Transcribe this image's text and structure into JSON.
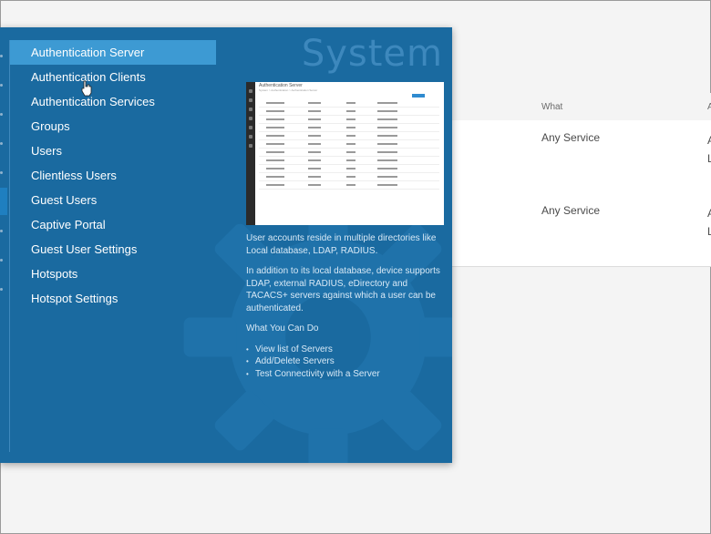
{
  "background": {
    "columns": {
      "what": "What",
      "second": "A"
    },
    "rows": [
      {
        "what": "Any Service",
        "second": [
          "A",
          "L"
        ]
      },
      {
        "what": "Any Service",
        "second": [
          "A",
          "L"
        ]
      }
    ]
  },
  "panel": {
    "title": "System",
    "nav": {
      "items": [
        {
          "label": "Authentication Server",
          "active": true
        },
        {
          "label": "Authentication Clients"
        },
        {
          "label": "Authentication Services"
        },
        {
          "label": "Groups"
        },
        {
          "label": "Users"
        },
        {
          "label": "Clientless Users"
        },
        {
          "label": "Guest Users"
        },
        {
          "label": "Captive Portal"
        },
        {
          "label": "Guest User Settings"
        },
        {
          "label": "Hotspots"
        },
        {
          "label": "Hotspot Settings"
        }
      ]
    },
    "preview": {
      "title": "Authentication Server",
      "breadcrumb": "System > Authentication > Authentication Server"
    },
    "description": {
      "para1": "User accounts reside in multiple directories like Local database, LDAP, RADIUS.",
      "para2": "In addition to its local database, device supports LDAP, external RADIUS, eDirectory and TACACS+ servers against which a user can be authenticated.",
      "what_you_can_do": "What You Can Do",
      "actions": [
        "View list of Servers",
        "Add/Delete Servers",
        "Test Connectivity with a Server"
      ]
    }
  },
  "colors": {
    "panel_bg": "#1a6aa0",
    "nav_active": "#3d9ad3",
    "accent": "#2f8bd0"
  }
}
